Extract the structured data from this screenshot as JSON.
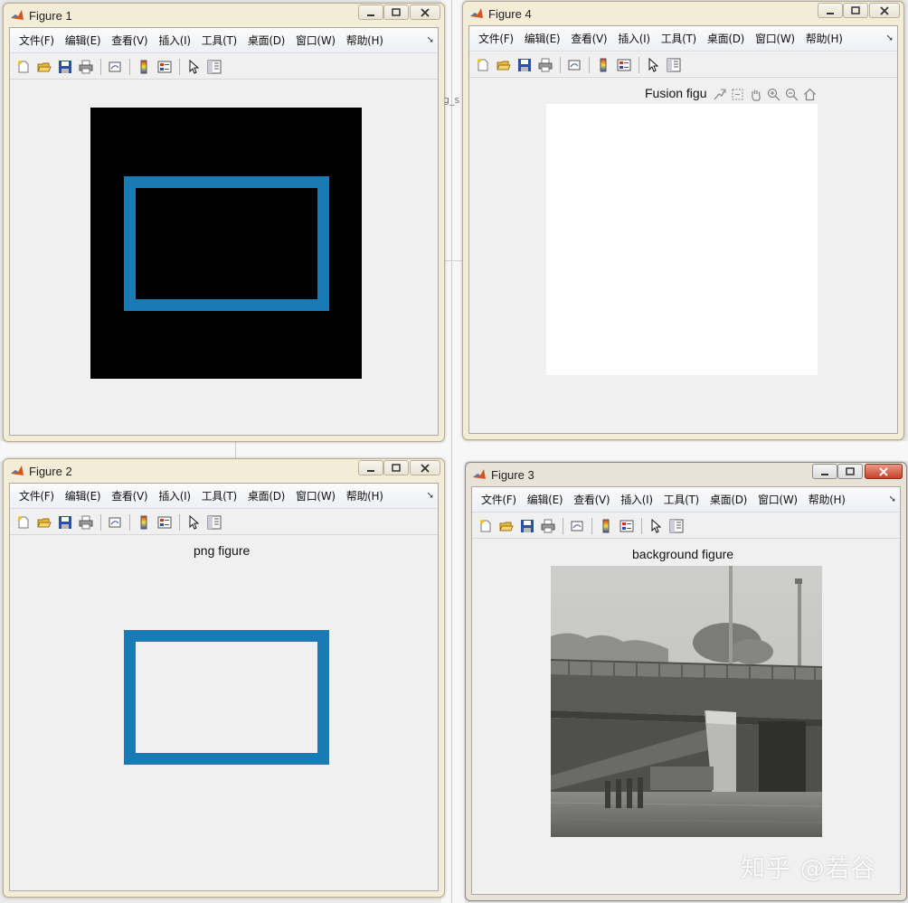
{
  "desktop": {
    "fragment_text": "g_s"
  },
  "menu": [
    "文件(F)",
    "编辑(E)",
    "查看(V)",
    "插入(I)",
    "工具(T)",
    "桌面(D)",
    "窗口(W)",
    "帮助(H)"
  ],
  "windows": {
    "fig1": {
      "title": "Figure 1",
      "axes_title": ""
    },
    "fig4": {
      "title": "Figure 4",
      "axes_title": "Fusion figu"
    },
    "fig2": {
      "title": "Figure 2",
      "axes_title": "png figure"
    },
    "fig3": {
      "title": "Figure 3",
      "axes_title": "background figure"
    }
  },
  "icons": {
    "toolbar": [
      "new-figure-icon",
      "open-file-icon",
      "save-icon",
      "print-icon",
      "link-plot-icon",
      "colorbar-icon",
      "legend-icon",
      "edit-plot-arrow-icon",
      "property-inspector-icon"
    ],
    "axes_toolbar": [
      "data-tip-icon",
      "brush-icon",
      "pan-hand-icon",
      "zoom-in-icon",
      "zoom-out-icon",
      "home-restore-icon"
    ]
  },
  "colors": {
    "rect_blue": "#1a7ab4",
    "matlab_orange": "#d9531e"
  },
  "watermark": "知乎 @若谷"
}
